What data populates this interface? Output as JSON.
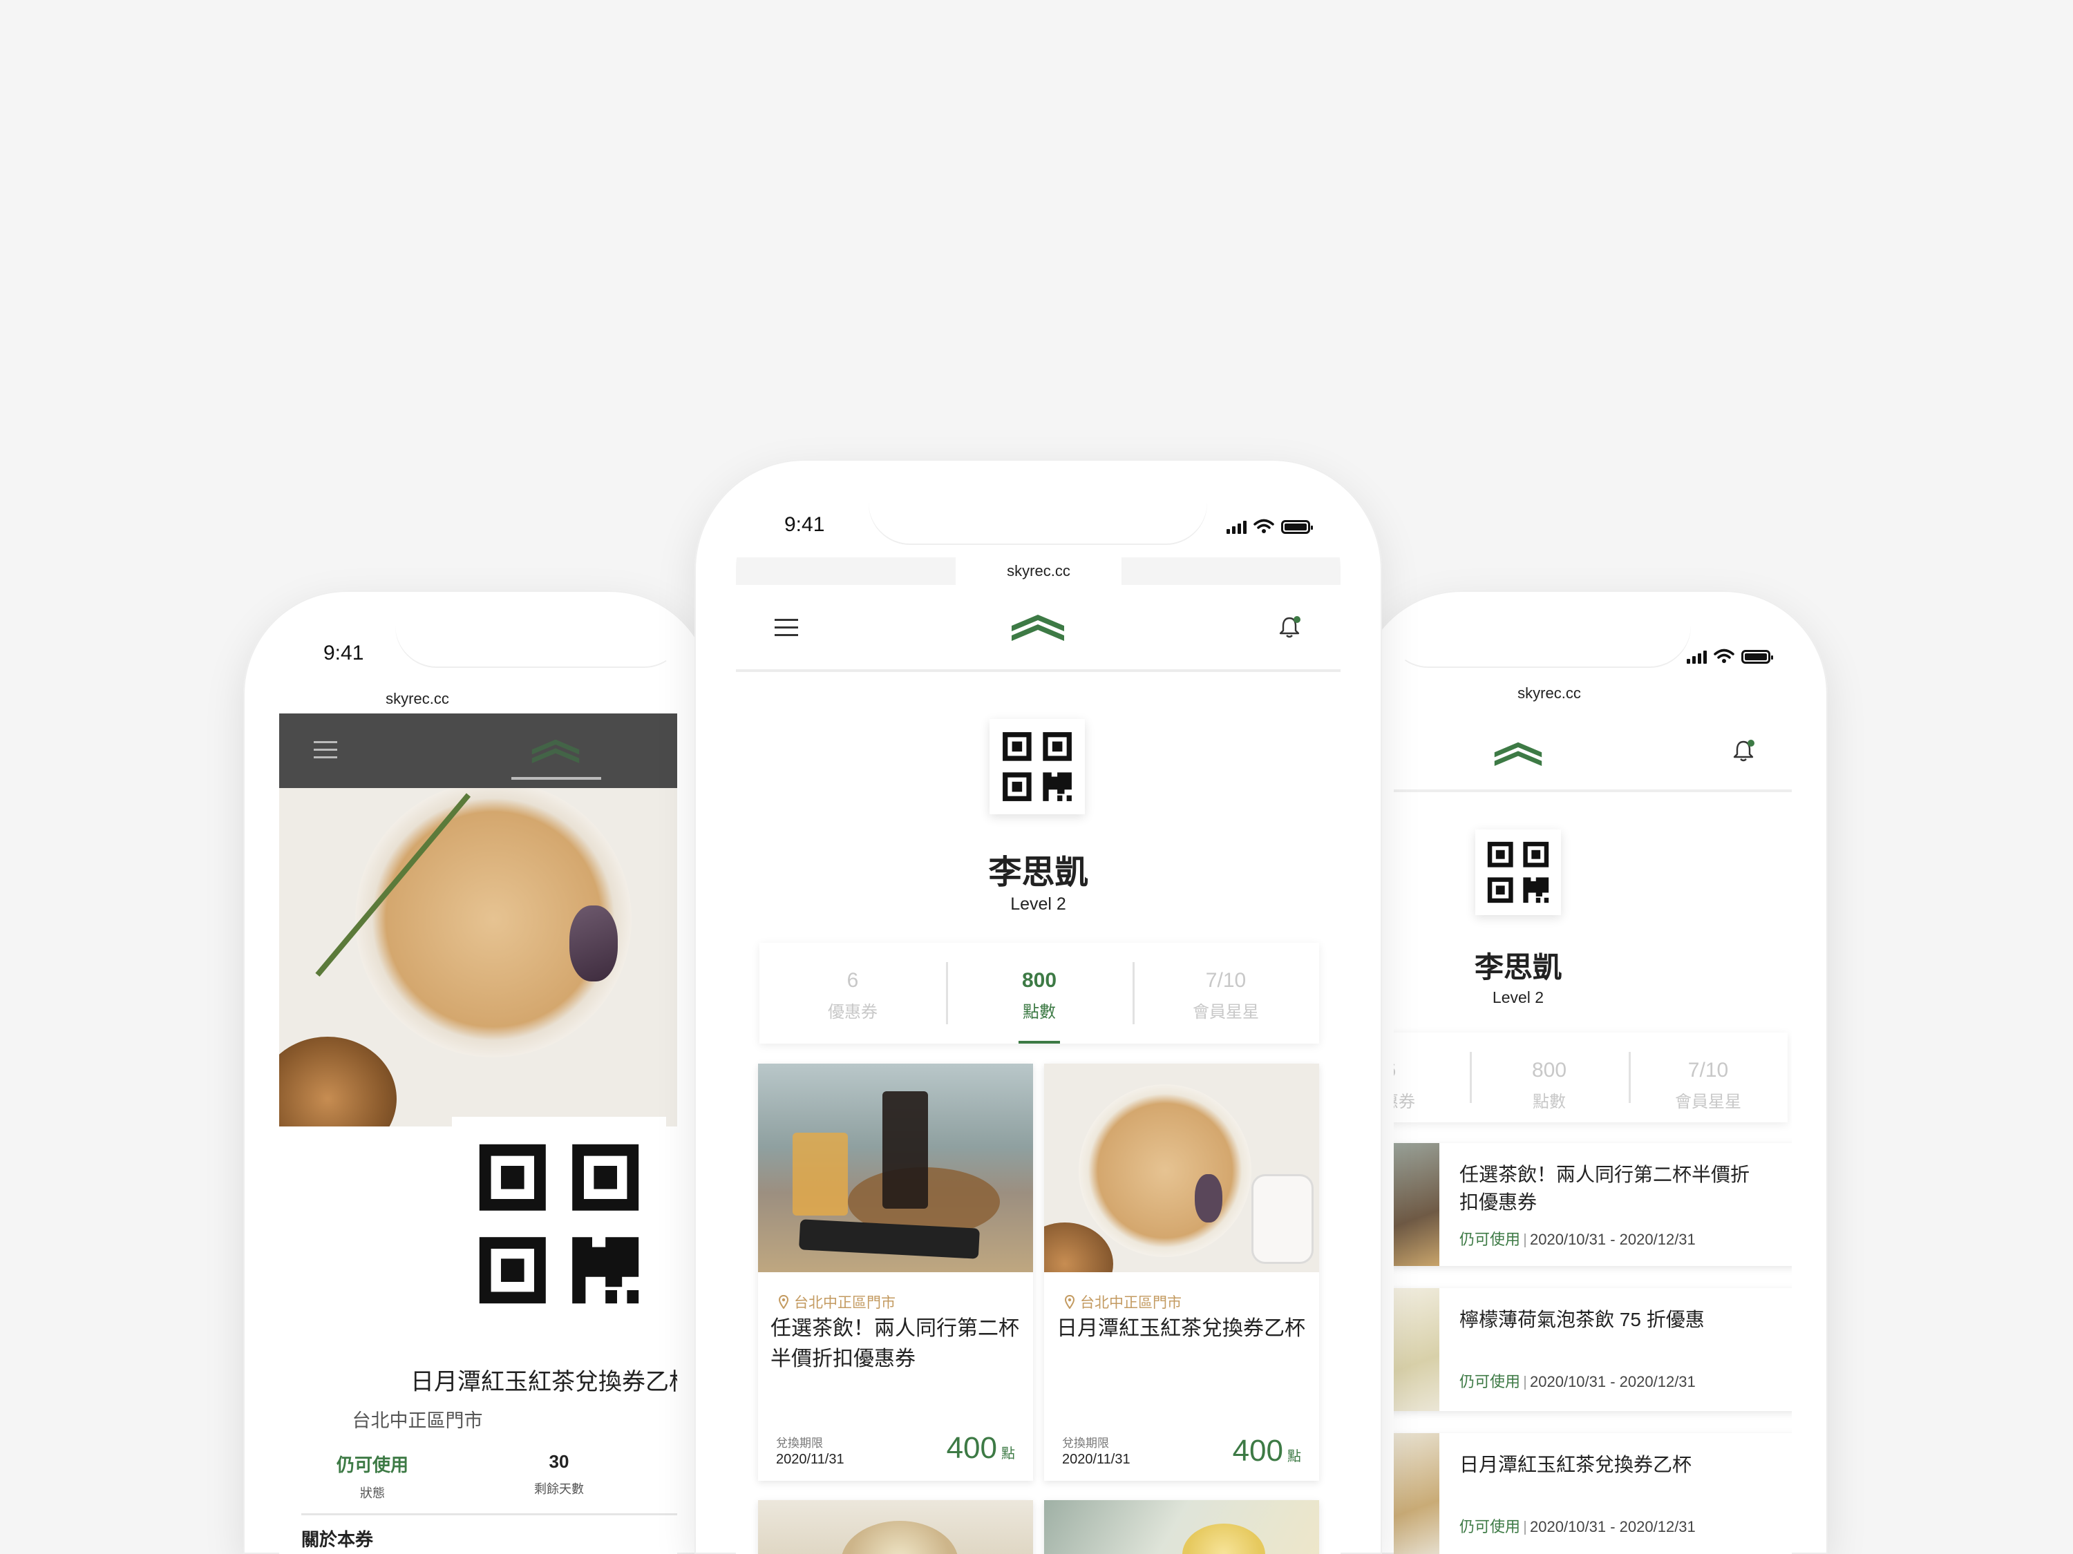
{
  "status_bar": {
    "time": "9:41"
  },
  "browser": {
    "url": "skyrec.cc"
  },
  "profile": {
    "name": "李思凱",
    "level": "Level 2"
  },
  "stats": [
    {
      "value": "6",
      "label": "優惠券"
    },
    {
      "value": "800",
      "label": "點數"
    },
    {
      "value": "7/10",
      "label": "會員星星"
    }
  ],
  "cards": [
    {
      "location": "台北中正區門市",
      "title": "任選茶飲！兩人同行第二杯半價折扣優惠券",
      "expiry_label": "兌換期限",
      "expiry": "2020/11/31",
      "points": "400",
      "unit": "點"
    },
    {
      "location": "台北中正區門市",
      "title": "日月潭紅玉紅茶兌換券乙杯",
      "expiry_label": "兌換期限",
      "expiry": "2020/11/31",
      "points": "400",
      "unit": "點"
    }
  ],
  "voucher": {
    "title": "日月潭紅玉紅茶兌換券乙杯",
    "store": "台北中正區門市",
    "status_value": "仍可使用",
    "status_label": "狀態",
    "days_value": "30",
    "days_label": "剩餘天數",
    "about": "關於本券"
  },
  "coupon_list": [
    {
      "title": "任選茶飲！兩人同行第二杯半價折扣優惠券",
      "status": "仍可使用",
      "period": "2020/10/31 - 2020/12/31"
    },
    {
      "title": "檸檬薄荷氣泡茶飲 75 折優惠",
      "status": "仍可使用",
      "period": "2020/10/31 - 2020/12/31"
    },
    {
      "title": "日月潭紅玉紅茶兌換券乙杯",
      "status": "仍可使用",
      "period": "2020/10/31 - 2020/12/31"
    }
  ],
  "colors": {
    "accent": "#3d7a45",
    "location": "#c39a60",
    "background": "#f5f5f5"
  },
  "icons": [
    "menu-icon",
    "logo-icon",
    "bell-icon",
    "location-pin-icon",
    "qr-code-icon",
    "signal-icon",
    "wifi-icon",
    "battery-icon"
  ]
}
